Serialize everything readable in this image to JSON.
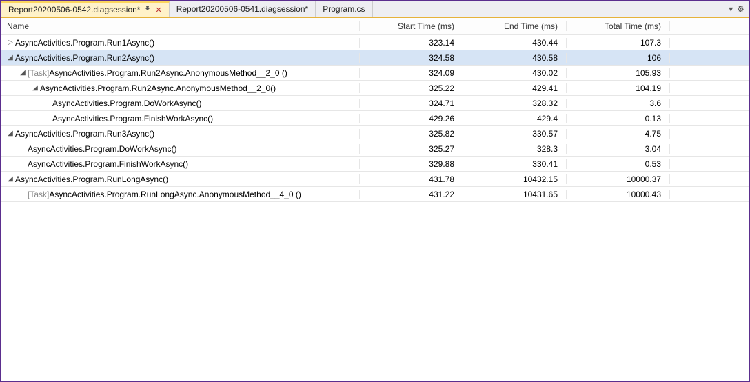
{
  "tabs": [
    {
      "label": "Report20200506-0542.diagsession*",
      "pinned": true,
      "closeable": true,
      "selected": true
    },
    {
      "label": "Report20200506-0541.diagsession*",
      "pinned": false,
      "closeable": false,
      "selected": false
    },
    {
      "label": "Program.cs",
      "pinned": false,
      "closeable": false,
      "selected": false
    }
  ],
  "columns": {
    "name": "Name",
    "start": "Start Time (ms)",
    "end": "End Time (ms)",
    "total": "Total Time (ms)"
  },
  "rows": [
    {
      "indent": 0,
      "expander": "closed",
      "name": "AsyncActivities.Program.Run1Async()",
      "start": "323.14",
      "end": "430.44",
      "total": "107.3",
      "selected": false
    },
    {
      "indent": 0,
      "expander": "open",
      "name": "AsyncActivities.Program.Run2Async()",
      "start": "324.58",
      "end": "430.58",
      "total": "106",
      "selected": true
    },
    {
      "indent": 1,
      "expander": "open",
      "taskprefix": "[Task] ",
      "name": "AsyncActivities.Program.Run2Async.AnonymousMethod__2_0 ()",
      "start": "324.09",
      "end": "430.02",
      "total": "105.93",
      "selected": false
    },
    {
      "indent": 2,
      "expander": "open",
      "name": "AsyncActivities.Program.Run2Async.AnonymousMethod__2_0()",
      "start": "325.22",
      "end": "429.41",
      "total": "104.19",
      "selected": false
    },
    {
      "indent": 3,
      "expander": "none",
      "name": "AsyncActivities.Program.DoWorkAsync()",
      "start": "324.71",
      "end": "328.32",
      "total": "3.6",
      "selected": false
    },
    {
      "indent": 3,
      "expander": "none",
      "name": "AsyncActivities.Program.FinishWorkAsync()",
      "start": "429.26",
      "end": "429.4",
      "total": "0.13",
      "selected": false
    },
    {
      "indent": 0,
      "expander": "open",
      "name": "AsyncActivities.Program.Run3Async()",
      "start": "325.82",
      "end": "330.57",
      "total": "4.75",
      "selected": false
    },
    {
      "indent": 1,
      "expander": "none",
      "name": "AsyncActivities.Program.DoWorkAsync()",
      "start": "325.27",
      "end": "328.3",
      "total": "3.04",
      "selected": false
    },
    {
      "indent": 1,
      "expander": "none",
      "name": "AsyncActivities.Program.FinishWorkAsync()",
      "start": "329.88",
      "end": "330.41",
      "total": "0.53",
      "selected": false
    },
    {
      "indent": 0,
      "expander": "open",
      "name": "AsyncActivities.Program.RunLongAsync()",
      "start": "431.78",
      "end": "10432.15",
      "total": "10000.37",
      "selected": false
    },
    {
      "indent": 1,
      "expander": "none",
      "taskprefix": "[Task] ",
      "name": "AsyncActivities.Program.RunLongAsync.AnonymousMethod__4_0 ()",
      "start": "431.22",
      "end": "10431.65",
      "total": "10000.43",
      "selected": false
    }
  ],
  "glyphs": {
    "pin": "�ографія",
    "gear": "⚙",
    "dropdown": "▾",
    "close": "✕",
    "expander_open": "◢",
    "expander_closed": "▷"
  }
}
